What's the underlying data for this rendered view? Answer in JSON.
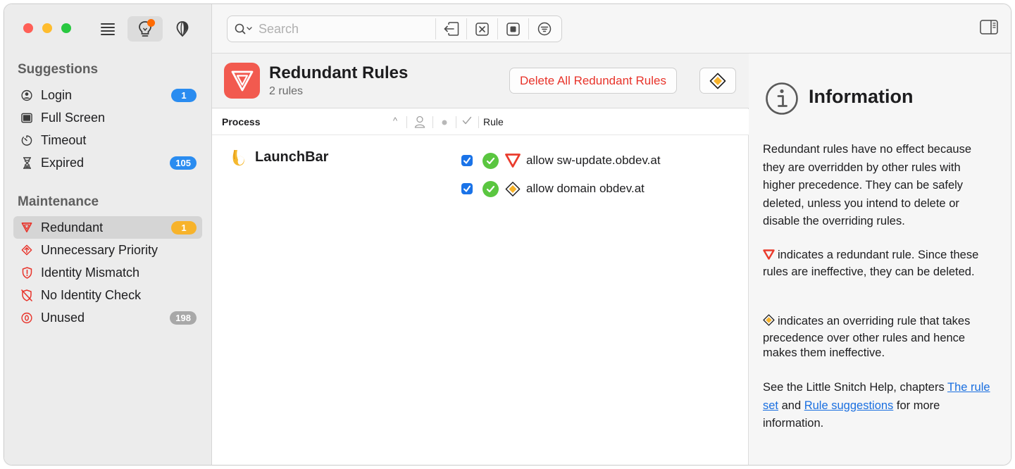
{
  "sidebar": {
    "sections": [
      {
        "title": "Suggestions",
        "items": [
          {
            "label": "Login",
            "icon": "person-circle-icon",
            "badge": "1",
            "badge_color": "#2a8cf0"
          },
          {
            "label": "Full Screen",
            "icon": "rectangle-fill-icon"
          },
          {
            "label": "Timeout",
            "icon": "timer-icon"
          },
          {
            "label": "Expired",
            "icon": "hourglass-icon",
            "badge": "105",
            "badge_color": "#2a8cf0"
          }
        ]
      },
      {
        "title": "Maintenance",
        "items": [
          {
            "label": "Redundant",
            "icon": "redundant-triangle-icon",
            "badge": "1",
            "badge_color": "#f7b32b",
            "selected": true
          },
          {
            "label": "Unnecessary Priority",
            "icon": "priority-up-icon"
          },
          {
            "label": "Identity Mismatch",
            "icon": "shield-exclamation-icon"
          },
          {
            "label": "No Identity Check",
            "icon": "shield-slash-icon"
          },
          {
            "label": "Unused",
            "icon": "zero-circle-icon",
            "badge": "198",
            "badge_color": "#a8a8a8"
          }
        ]
      }
    ]
  },
  "toolbar": {
    "search_placeholder": "Search"
  },
  "main": {
    "title": "Redundant Rules",
    "subtitle": "2 rules",
    "delete_button": "Delete All Redundant Rules",
    "columns": {
      "process": "Process",
      "rule": "Rule"
    },
    "process": {
      "name": "LaunchBar"
    },
    "rules": [
      {
        "text": "allow sw-update.obdev.at",
        "checked": true,
        "kind": "redundant"
      },
      {
        "text": "allow domain obdev.at",
        "checked": true,
        "kind": "overriding"
      }
    ]
  },
  "info": {
    "title": "Information",
    "p1": "Redundant rules have no effect because they are overridden by other rules with higher precedence. They can be safely deleted, unless you intend to delete or disable the overriding rules.",
    "p2": "indicates a redundant rule. Since these rules are ineffective, they can be deleted.",
    "p3": "indicates an overriding rule that takes precedence over other rules and hence makes them ineffective.",
    "p4_pre": "See the Little Snitch Help, chapters ",
    "p4_link1": "The rule set",
    "p4_mid": " and ",
    "p4_link2": "Rule suggestions",
    "p4_post": " for more information."
  },
  "colors": {
    "accent_red": "#e8332a",
    "redundant_orange": "#f25a4f",
    "override_yellow": "#f7b32b",
    "allow_green": "#5ac640",
    "checkbox_blue": "#1a73e8",
    "link_blue": "#1a6fe0"
  }
}
